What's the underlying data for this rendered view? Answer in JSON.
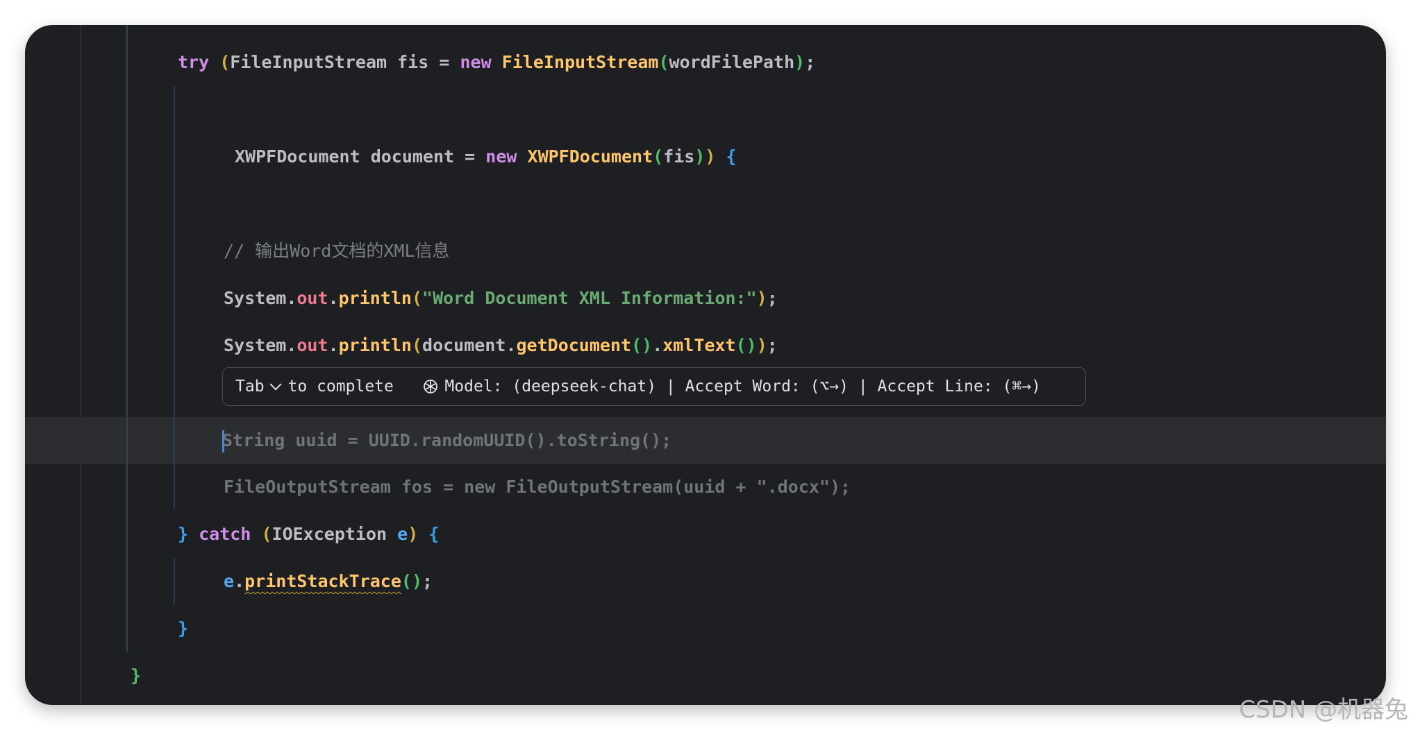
{
  "editor": {
    "lines": {
      "try_kw": "try",
      "try_type": "FileInputStream",
      "try_var": "fis",
      "try_new": "new",
      "try_ctor": "FileInputStream",
      "try_arg": "wordFilePath",
      "doc_type": "XWPFDocument",
      "doc_var": "document",
      "doc_new": "new",
      "doc_ctor": "XWPFDocument",
      "doc_arg": "fis",
      "comment": "// 输出Word文档的XML信息",
      "print1_obj": "System",
      "print1_field": "out",
      "print1_fn": "println",
      "print1_str": "\"Word Document XML Information:\"",
      "print2_obj": "System",
      "print2_field": "out",
      "print2_fn": "println",
      "print2_arg": "document",
      "print2_fn2": "getDocument",
      "print2_fn3": "xmlText",
      "ghost1": "String uuid = UUID.randomUUID().toString();",
      "ghost2": "FileOutputStream fos = new FileOutputStream(uuid + \".docx\");",
      "catch_kw": "catch",
      "catch_type": "IOException",
      "catch_var": "e",
      "stack_var": "e",
      "stack_fn": "printStackTrace"
    }
  },
  "completion_hint": {
    "tab_label": "Tab",
    "to_complete": "to complete",
    "model_icon": "openai-icon",
    "model_text": "Model: (deepseek-chat) | Accept Word: (⌥→) | Accept Line: (⌘→)"
  },
  "watermark": "CSDN @机器兔",
  "colors": {
    "background": "#1e1f22",
    "keyword": "#cf8ee8",
    "function": "#ffc66d",
    "string": "#6aab73",
    "field": "#ee7b8f",
    "comment": "#7a7e85"
  }
}
